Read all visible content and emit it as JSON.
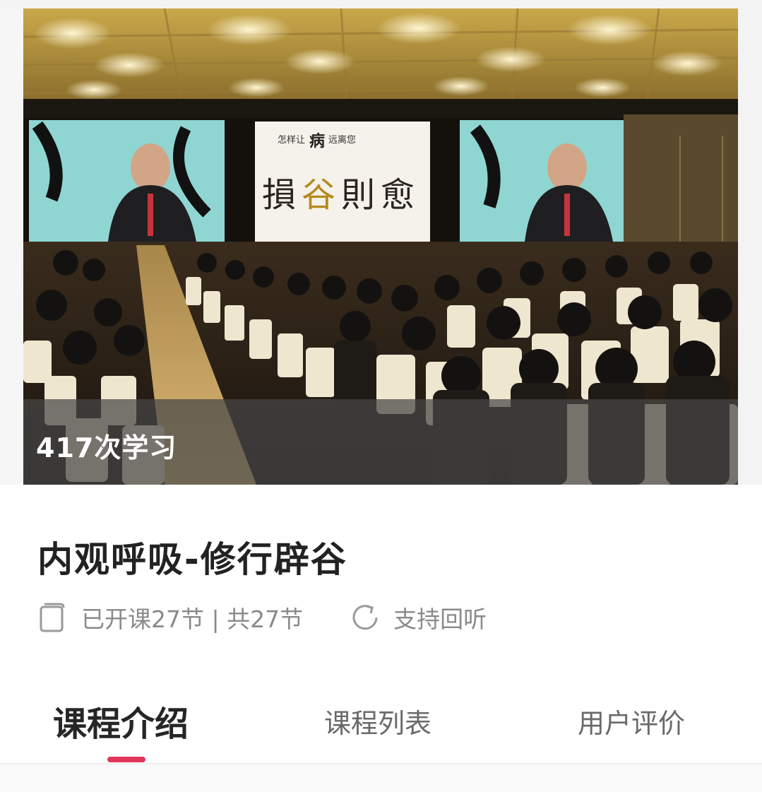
{
  "cover": {
    "study_count": "417次学习",
    "screen_text": {
      "banner_small": "怎样让",
      "banner_big": "病",
      "banner_tail": "远离您",
      "main_chars": [
        "損",
        "谷",
        "則",
        "愈"
      ]
    }
  },
  "course": {
    "title": "内观呼吸-修行辟谷",
    "lessons_text": "已开课27节 | 共27节",
    "replay_text": "支持回听"
  },
  "tabs": [
    {
      "label": "课程介绍",
      "active": true
    },
    {
      "label": "课程列表",
      "active": false
    },
    {
      "label": "用户评价",
      "active": false
    }
  ],
  "icons": {
    "lessons": "book-icon",
    "replay": "refresh-icon"
  },
  "colors": {
    "accent": "#e2375a",
    "title": "#222222",
    "meta": "#8a8a8a",
    "tab_inactive": "#6a6a6a"
  }
}
